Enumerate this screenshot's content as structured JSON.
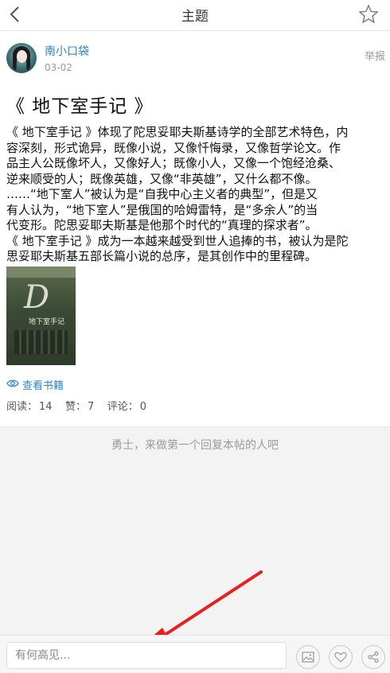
{
  "header": {
    "title": "主题",
    "back_icon": "chevron-left-icon",
    "favorite_icon": "star-outline-icon"
  },
  "post": {
    "author": "南小口袋",
    "date": "03-02",
    "report_label": "举报",
    "title": "《 地下室手记 》",
    "content_lines": [
      "《 地下室手记 》体现了陀思妥耶夫斯基诗学的全部艺术特色，内",
      "容深刻，形式诡异，既像小说，又像忏悔录，又像哲学论文。作",
      "品主人公既像坏人，又像好人；既像小人，又像一个饱经沧桑、",
      "逆来顺受的人；既像英雄，又像“非英雄”，又什么都不像。",
      "……“地下室人”被认为是“自我中心主义者的典型”，但是又",
      "有人认为，“地下室人”是俄国的哈姆雷特，是“多余人”的当",
      "代变形。陀思妥耶夫斯基是他那个时代的“真理的探求者”。",
      "《 地下室手记 》成为一本越来越受到世人追捧的书，被认为是陀",
      "思妥耶夫斯基五部长篇小说的总序，是其创作中的里程碑。"
    ],
    "book_cover_title": "地下室手记",
    "book_cover_letter": "D",
    "view_book_label": "查看书籍",
    "stats": {
      "read_label": "阅读：",
      "read_count": "14",
      "like_label": "赞：",
      "like_count": "7",
      "comment_label": "评论：",
      "comment_count": "0"
    }
  },
  "replies": {
    "empty_hint": "勇士，来做第一个回复本帖的人吧"
  },
  "bottom_bar": {
    "input_placeholder": "有何高见...",
    "buttons": [
      "image-icon",
      "heart-icon",
      "share-icon"
    ]
  },
  "colors": {
    "link": "#2b86c9",
    "annotation_arrow": "#e8201c"
  }
}
